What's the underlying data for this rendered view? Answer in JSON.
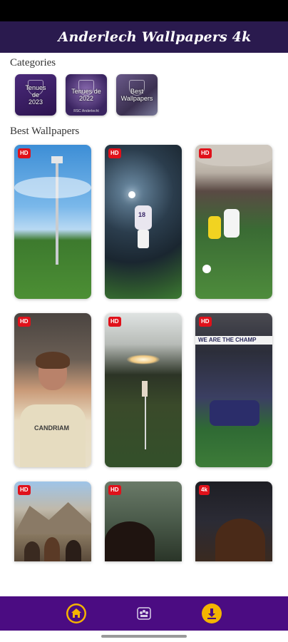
{
  "app": {
    "title": "Anderlech Wallpapers 4k"
  },
  "sections": {
    "categories": "Categories",
    "best": "Best Wallpapers"
  },
  "categories": [
    {
      "label": "Tenues\nde\n2023",
      "sub": ""
    },
    {
      "label": "Tenues de\n2022",
      "sub": "RSC Anderlecht"
    },
    {
      "label": "Best\nWallpapers",
      "sub": ""
    }
  ],
  "wallpapers": [
    {
      "badge": "HD",
      "scene": "stadium floodlight and grass pitch"
    },
    {
      "badge": "HD",
      "scene": "player jumping under lights"
    },
    {
      "badge": "HD",
      "scene": "match action on pitch"
    },
    {
      "badge": "HD",
      "scene": "smiling player portrait"
    },
    {
      "badge": "HD",
      "scene": "corner flag at sunset"
    },
    {
      "badge": "HD",
      "scene": "team huddle in stadium"
    },
    {
      "badge": "HD",
      "scene": "group photo in mountains"
    },
    {
      "badge": "HD",
      "scene": "player portrait"
    },
    {
      "badge": "4k",
      "scene": "player portrait in dark"
    }
  ],
  "tile_texts": {
    "t3_shirt": "18",
    "t6_banner": "WE ARE THE CHAMP",
    "t4_shirt": "CANDRIAM"
  },
  "nav": [
    {
      "icon": "home-icon"
    },
    {
      "icon": "club-crest-icon"
    },
    {
      "icon": "download-icon"
    }
  ],
  "colors": {
    "appbar": "#2a1a4e",
    "nav": "#4b0c82",
    "accent": "#f4b400",
    "badge": "#e0111a"
  }
}
